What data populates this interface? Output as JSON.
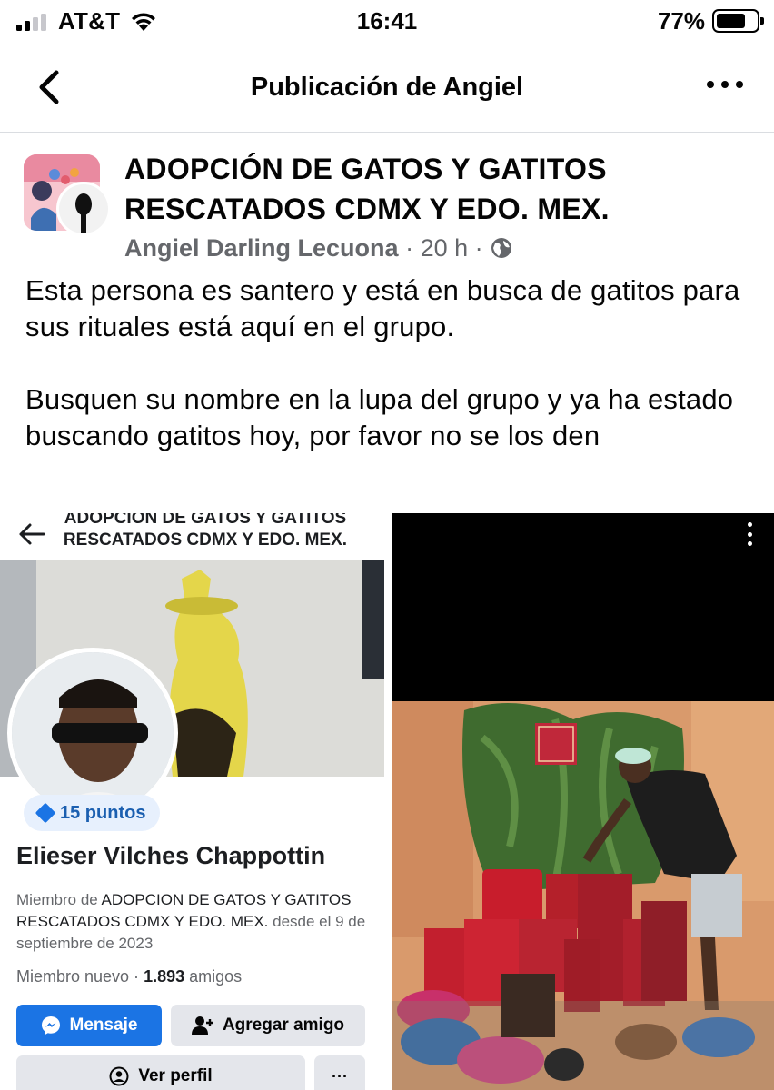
{
  "status_bar": {
    "carrier": "AT&T",
    "time": "16:41",
    "battery": "77%",
    "battery_level": 0.77,
    "signal_bars_filled": 2
  },
  "nav": {
    "title": "Publicación de Angiel",
    "back_icon": "chevron-left-icon",
    "more_icon": "more-horizontal-icon"
  },
  "post": {
    "group_name": "ADOPCIÓN DE GATOS Y GATITOS RESCATADOS CDMX Y EDO. MEX.",
    "author": "Angiel Darling Lecuona",
    "separator": "·",
    "time_ago": "20 h",
    "privacy_icon": "globe-icon",
    "text_paragraph_1": "Esta persona es santero y está en busca de gatitos para sus rituales está aquí en el grupo.",
    "text_paragraph_2": "Busquen su nombre en la lupa del grupo y ya ha estado buscando gatitos hoy, por favor no se los den"
  },
  "screenshot_left": {
    "group_title": "ADOPCION DE GATOS Y GATITOS RESCATADOS CDMX Y EDO. MEX.",
    "points": "15 puntos",
    "profile_name": "Elieser Vilches Chappottin",
    "member_prefix": "Miembro de ",
    "member_group": "ADOPCION DE GATOS Y GATITOS RESCATADOS CDMX Y EDO. MEX.",
    "member_since": " desde el 9 de septiembre de 2023",
    "status_label": "Miembro nuevo · ",
    "friends_count": "1.893",
    "friends_label": " amigos",
    "buttons": {
      "message": "Mensaje",
      "add_friend": "Agregar amigo",
      "view_profile": "Ver perfil",
      "more": "···"
    }
  },
  "colors": {
    "facebook_blue": "#1b74e4",
    "secondary_text": "#65676b",
    "button_gray": "#e4e6eb"
  }
}
